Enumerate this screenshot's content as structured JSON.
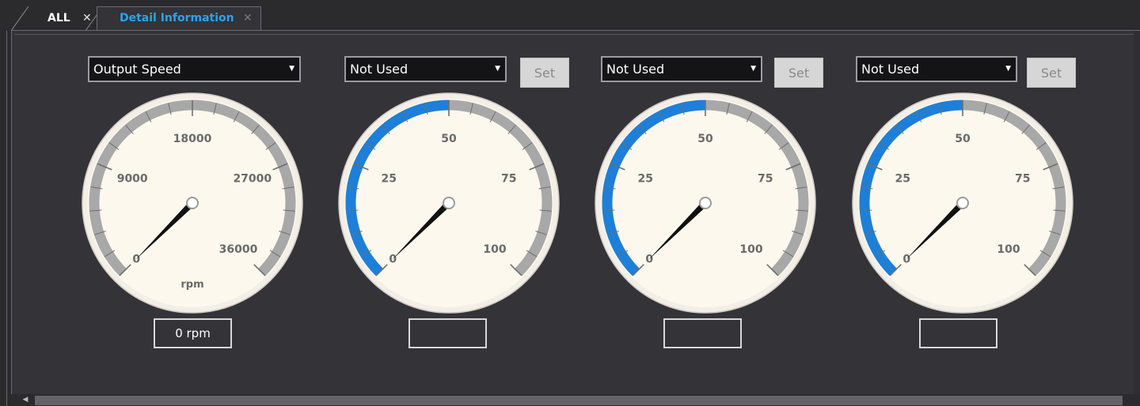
{
  "tabs": [
    {
      "label": "ALL",
      "close": "✕"
    },
    {
      "label": "Detail Information",
      "close": "✕"
    }
  ],
  "colors": {
    "accent": "#1e7fd8",
    "tab_active_text": "#2aa3ea",
    "dial_face": "#fdf8ee",
    "dial_rim": "#a8a8a8"
  },
  "gauges": [
    {
      "select_value": "Output Speed",
      "has_set_button": false,
      "set_label": "",
      "scale_labels": [
        "0",
        "9000",
        "18000",
        "27000",
        "36000"
      ],
      "unit": "rpm",
      "readout": "0 rpm",
      "value_fraction": 0.0,
      "highlight_fraction": 0.0
    },
    {
      "select_value": "Not Used",
      "has_set_button": true,
      "set_label": "Set",
      "scale_labels": [
        "0",
        "25",
        "50",
        "75",
        "100"
      ],
      "unit": "",
      "readout": "",
      "value_fraction": 0.0,
      "highlight_fraction": 0.5
    },
    {
      "select_value": "Not Used",
      "has_set_button": true,
      "set_label": "Set",
      "scale_labels": [
        "0",
        "25",
        "50",
        "75",
        "100"
      ],
      "unit": "",
      "readout": "",
      "value_fraction": 0.0,
      "highlight_fraction": 0.5
    },
    {
      "select_value": "Not Used",
      "has_set_button": true,
      "set_label": "Set",
      "scale_labels": [
        "0",
        "25",
        "50",
        "75",
        "100"
      ],
      "unit": "",
      "readout": "",
      "value_fraction": 0.0,
      "highlight_fraction": 0.5
    }
  ]
}
